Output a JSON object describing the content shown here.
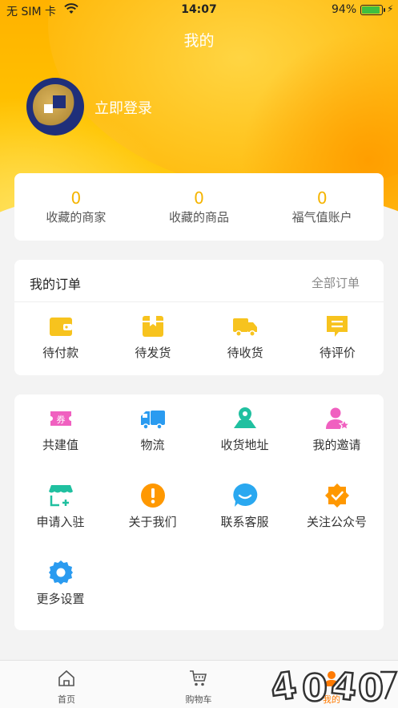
{
  "status_bar": {
    "carrier": "无 SIM 卡",
    "time": "14:07",
    "battery": "94%"
  },
  "page": {
    "title": "我的"
  },
  "profile": {
    "login_label": "立即登录"
  },
  "stats": [
    {
      "value": "0",
      "label": "收藏的商家"
    },
    {
      "value": "0",
      "label": "收藏的商品"
    },
    {
      "value": "0",
      "label": "福气值账户"
    }
  ],
  "orders": {
    "title": "我的订单",
    "all_label": "全部订单",
    "items": [
      {
        "label": "待付款",
        "icon": "wallet-icon"
      },
      {
        "label": "待发货",
        "icon": "package-icon"
      },
      {
        "label": "待收货",
        "icon": "truck-icon"
      },
      {
        "label": "待评价",
        "icon": "comment-icon"
      }
    ]
  },
  "services": {
    "items": [
      {
        "label": "共建值",
        "icon": "coupon-icon"
      },
      {
        "label": "物流",
        "icon": "delivery-truck-icon"
      },
      {
        "label": "收货地址",
        "icon": "map-pin-icon"
      },
      {
        "label": "我的邀请",
        "icon": "user-star-icon"
      },
      {
        "label": "申请入驻",
        "icon": "store-add-icon"
      },
      {
        "label": "关于我们",
        "icon": "info-icon"
      },
      {
        "label": "联系客服",
        "icon": "chat-icon"
      },
      {
        "label": "关注公众号",
        "icon": "badge-check-icon"
      },
      {
        "label": "更多设置",
        "icon": "settings-gear-icon"
      }
    ]
  },
  "tabbar": {
    "items": [
      {
        "label": "首页",
        "icon": "home-icon"
      },
      {
        "label": "购物车",
        "icon": "cart-icon"
      },
      {
        "label": "我的",
        "icon": "profile-icon"
      }
    ]
  },
  "colors": {
    "accent": "#f5b400",
    "active_tab": "#ff7a00",
    "brand_blue": "#1f2f7a"
  }
}
